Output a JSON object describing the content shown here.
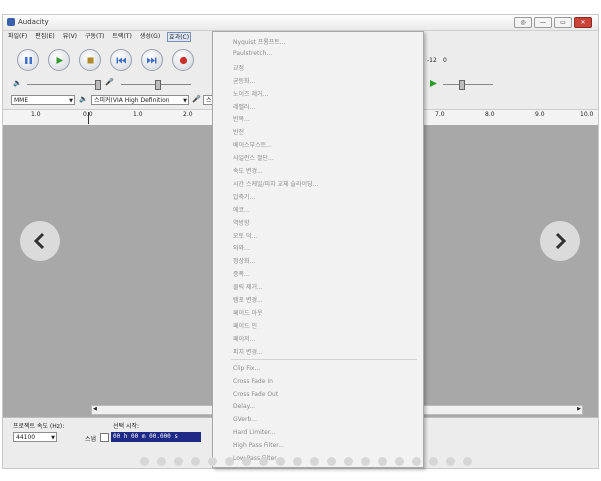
{
  "window": {
    "title": "Audacity",
    "buttons": [
      "◎",
      "—",
      "▭",
      "✕"
    ]
  },
  "menubar": [
    "파일(F)",
    "편집(E)",
    "뷰(V)",
    "구동(T)",
    "트랙(T)",
    "생성(G)",
    "효과(C)"
  ],
  "transport": {
    "colors": {
      "pause": "#3f6fc8",
      "play": "#2e9a2e",
      "stop": "#b08a2a",
      "record": "#c8302a"
    }
  },
  "toolbar_extra": {
    "meter_left": "-12",
    "meter_right": "0"
  },
  "device": {
    "host": "MME",
    "output_device": "스피커(VIA High Definition",
    "input_prefix": "스"
  },
  "ruler": {
    "ticks": [
      "1.0",
      "0.0",
      "1.0",
      "2.0",
      "7.0",
      "8.0",
      "9.0",
      "10.0"
    ]
  },
  "selection_toolbar": {
    "project_rate_label": "프로젝트 속도 (Hz):",
    "project_rate_value": "44100",
    "selection_start_label": "선택 시작:",
    "snap_label": "스냅",
    "start_time": "00 h 00 m 00.000 s"
  },
  "effect_menu": {
    "group1": [
      "Nyquist 프롬프트...",
      "Paulstretch...",
      "교정",
      "균등화...",
      "노이즈 제거...",
      "레벨러...",
      "반복...",
      "반전",
      "베이스부스트...",
      "사일런스 절단...",
      "속도 변경...",
      "시간 스케일/피치 교체 슬라이딩...",
      "압축기...",
      "에코...",
      "역방향",
      "오토 덕...",
      "와와...",
      "정상화...",
      "증폭...",
      "클릭 제거...",
      "템포 변경...",
      "페이드 아웃",
      "페이드 인",
      "페이저...",
      "피치 변경..."
    ],
    "group2": [
      "Clip Fix...",
      "Cross Fade In",
      "Cross Fade Out",
      "Delay...",
      "GVerb...",
      "Hard Limiter...",
      "High Pass Filter...",
      "Low Pass Filter..."
    ]
  },
  "nav": {
    "prev": "❮",
    "next": "❯"
  },
  "carousel_dots": 20
}
